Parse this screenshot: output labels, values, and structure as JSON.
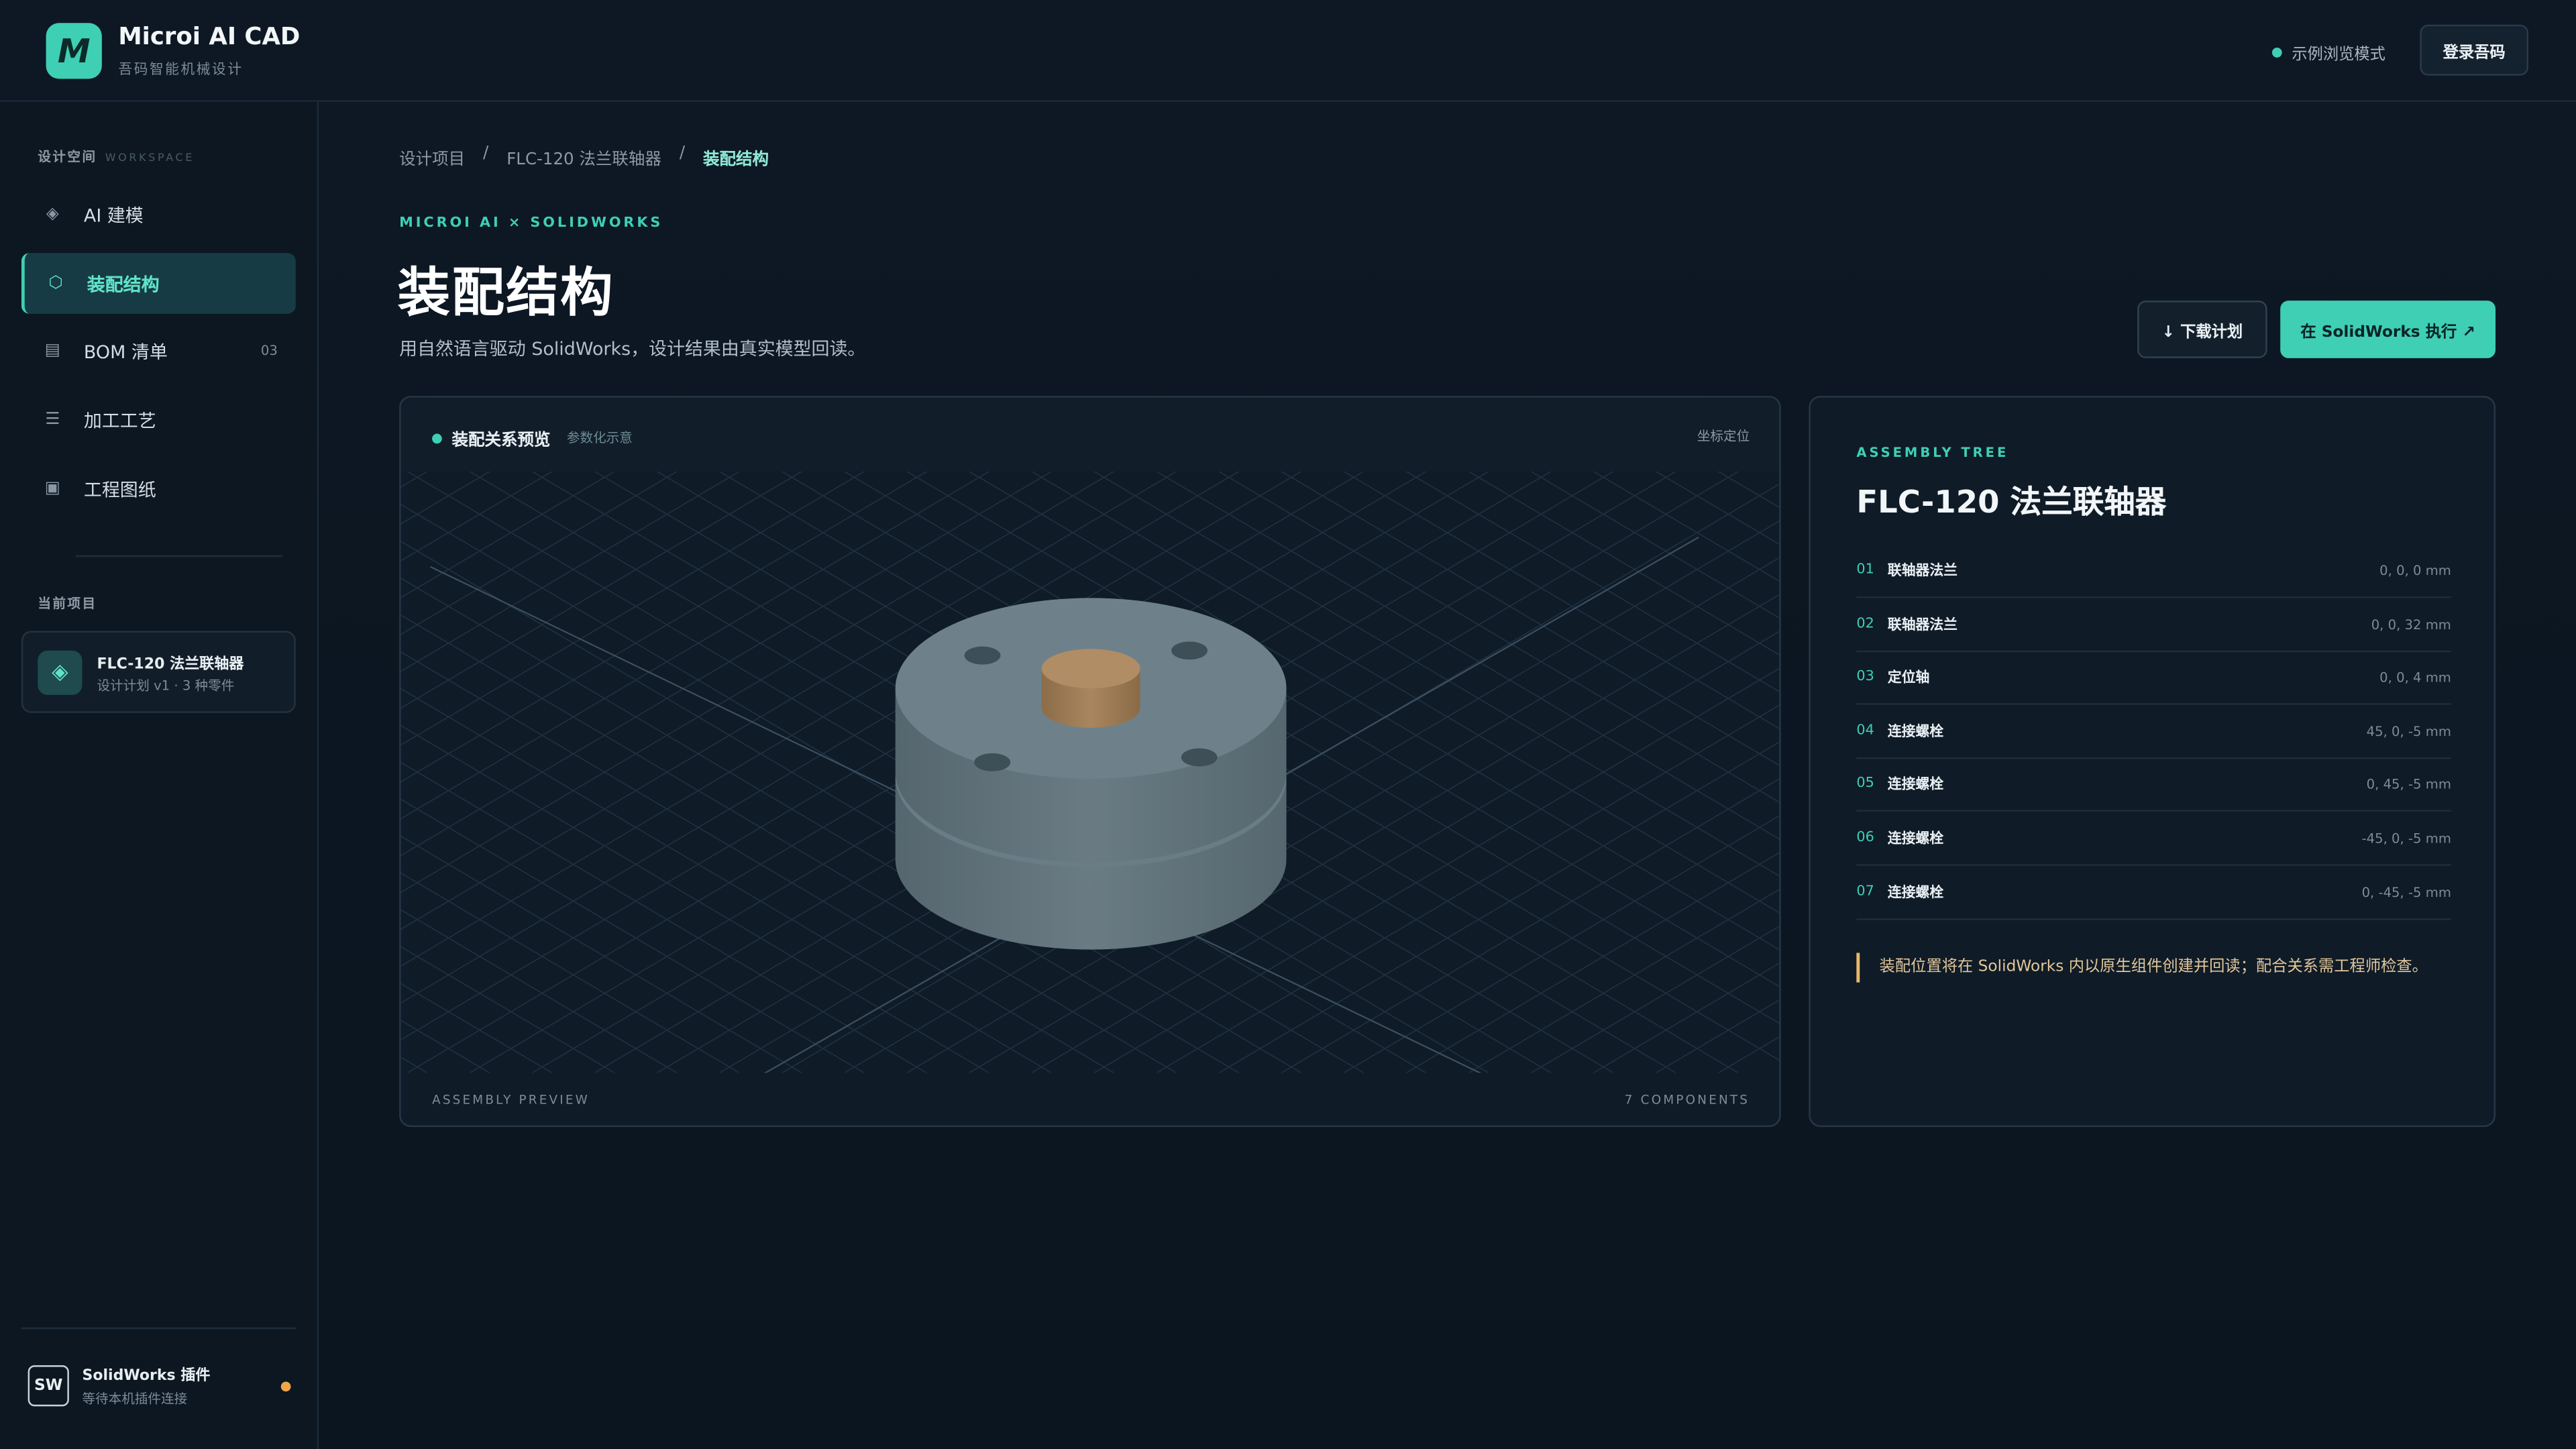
{
  "header": {
    "logo_letter": "M",
    "title": "Microi AI CAD",
    "subtitle": "吾码智能机械设计",
    "mode_label": "示例浏览模式",
    "login_label": "登录吾码"
  },
  "sidebar": {
    "workspace_label": "设计空间",
    "workspace_label_en": "WORKSPACE",
    "items": [
      {
        "icon": "◈",
        "label": "AI 建模",
        "count": ""
      },
      {
        "icon": "⬡",
        "label": "装配结构",
        "count": ""
      },
      {
        "icon": "▤",
        "label": "BOM 清单",
        "count": "03"
      },
      {
        "icon": "☰",
        "label": "加工工艺",
        "count": ""
      },
      {
        "icon": "▣",
        "label": "工程图纸",
        "count": ""
      }
    ],
    "current_project_label": "当前项目",
    "project": {
      "name": "FLC-120 法兰联轴器",
      "meta": "设计计划 v1 · 3 种零件"
    },
    "plugin": {
      "badge": "SW",
      "title": "SolidWorks 插件",
      "status": "等待本机插件连接"
    }
  },
  "breadcrumb": [
    "设计项目",
    "FLC-120 法兰联轴器",
    "装配结构"
  ],
  "main": {
    "eyebrow": "MICROI AI × SOLIDWORKS",
    "title": "装配结构",
    "description": "用自然语言驱动 SolidWorks，设计结果由真实模型回读。",
    "download_label": "↓ 下载计划",
    "run_label": "在 SolidWorks 执行 ↗"
  },
  "preview": {
    "title": "装配关系预览",
    "tag": "参数化示意",
    "right_label": "坐标定位",
    "footer_left": "ASSEMBLY PREVIEW",
    "footer_right": "7 COMPONENTS"
  },
  "tree": {
    "eyebrow": "ASSEMBLY TREE",
    "title": "FLC-120 法兰联轴器",
    "rows": [
      {
        "num": "01",
        "name": "联轴器法兰",
        "pos": "0, 0, 0 mm"
      },
      {
        "num": "02",
        "name": "联轴器法兰",
        "pos": "0, 0, 32 mm"
      },
      {
        "num": "03",
        "name": "定位轴",
        "pos": "0, 0, 4 mm"
      },
      {
        "num": "04",
        "name": "连接螺栓",
        "pos": "45, 0, -5 mm"
      },
      {
        "num": "05",
        "name": "连接螺栓",
        "pos": "0, 45, -5 mm"
      },
      {
        "num": "06",
        "name": "连接螺栓",
        "pos": "-45, 0, -5 mm"
      },
      {
        "num": "07",
        "name": "连接螺栓",
        "pos": "0, -45, -5 mm"
      }
    ],
    "note": "装配位置将在 SolidWorks 内以原生组件创建并回读；配合关系需工程师检查。"
  },
  "colors": {
    "accent": "#3ecfb4",
    "background": "#0b1520",
    "warning": "#f0a54a",
    "flange": "#6f8290",
    "shaft": "#a9865e"
  }
}
